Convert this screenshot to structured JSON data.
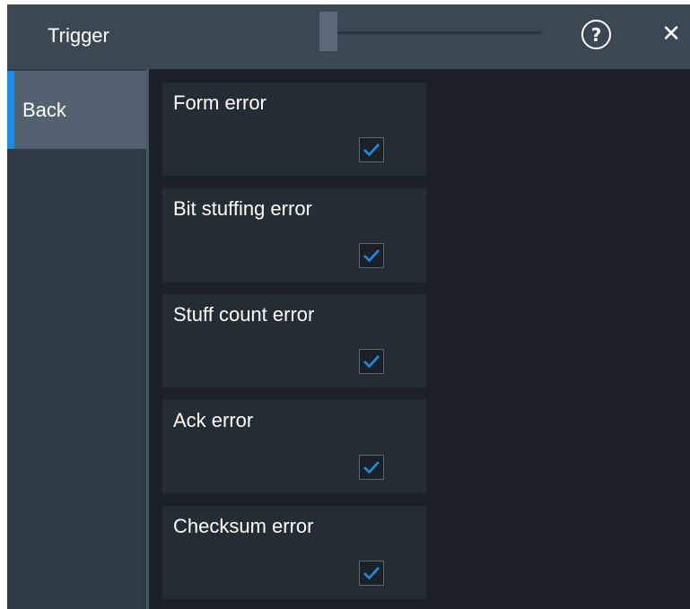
{
  "header": {
    "title": "Trigger",
    "help_glyph": "?",
    "close_glyph": "✕"
  },
  "sidebar": {
    "back_label": "Back"
  },
  "options": [
    {
      "label": "Form error",
      "checked": true
    },
    {
      "label": "Bit stuffing error",
      "checked": true
    },
    {
      "label": "Stuff count error",
      "checked": true
    },
    {
      "label": "Ack error",
      "checked": true
    },
    {
      "label": "Checksum error",
      "checked": true
    }
  ],
  "colors": {
    "accent": "#1a8fe8",
    "checkmark": "#1a8fe8"
  }
}
